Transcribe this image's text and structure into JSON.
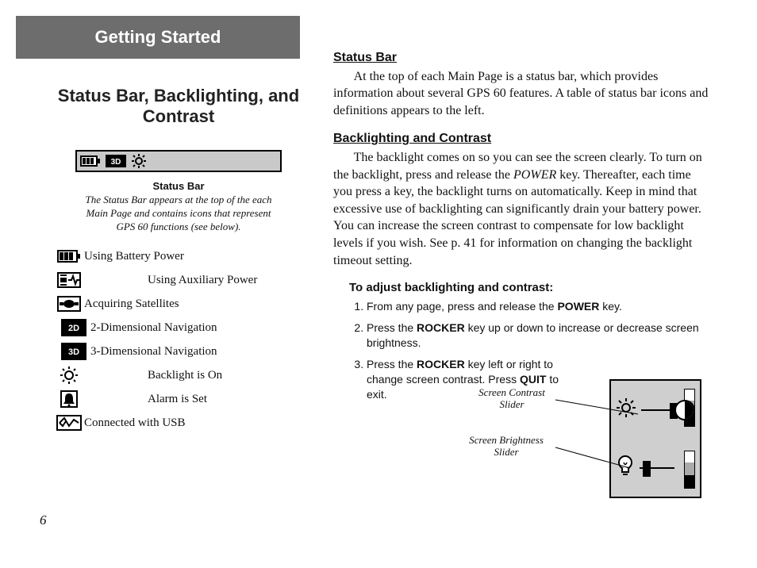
{
  "chapter": "Getting Started",
  "section_title": "Status Bar, Backlighting, and Contrast",
  "statusbar_caption_head": "Status Bar",
  "statusbar_caption": "The Status Bar appears at the top of the each Main Page and contains icons that represent GPS 60 functions (see below).",
  "icons": [
    {
      "id": "battery",
      "label": "Using Battery Power",
      "indent": false
    },
    {
      "id": "aux-power",
      "label": "Using Auxiliary Power",
      "indent": true
    },
    {
      "id": "sat",
      "label": "Acquiring Satellites",
      "indent": false
    },
    {
      "id": "nav2d",
      "label": "2-Dimensional Navigation",
      "indent": false,
      "short": true
    },
    {
      "id": "nav3d",
      "label": "3-Dimensional Navigation",
      "indent": false,
      "short": true
    },
    {
      "id": "backlight",
      "label": "Backlight is On",
      "indent": true
    },
    {
      "id": "alarm",
      "label": "Alarm is Set",
      "indent": true
    },
    {
      "id": "usb",
      "label": "Connected with USB",
      "indent": false
    }
  ],
  "right": {
    "h1": "Status Bar",
    "p1": "At the top of each Main Page is a status bar, which provides information about several GPS 60 features. A table of status bar icons and definitions appears to the left.",
    "h2": "Backlighting and Contrast",
    "p2a": "The backlight comes on so you can see the screen clearly. To turn on the backlight, press and release the ",
    "p2_power": "POWER",
    "p2b": " key. Thereafter, each time you press a key, the backlight turns on automatically. Keep in mind that excessive use of backlighting can significantly drain your battery power. You can increase the screen contrast to compensate for low backlight levels if you wish. See p. 41 for information on changing the backlight timeout setting.",
    "proc_head": "To adjust backlighting and contrast:",
    "steps": {
      "s1a": "From any page, press and release the ",
      "s1_power": "POWER",
      "s1b": " key.",
      "s2a": "Press the ",
      "s2_rocker": "ROCKER",
      "s2b": " key up or down to increase or decrease screen brightness.",
      "s3a": "Press the ",
      "s3_rocker": "ROCKER",
      "s3b": " key left or right to change screen contrast. Press ",
      "s3_quit": "QUIT",
      "s3c": " to exit."
    }
  },
  "callouts": {
    "contrast": "Screen Contrast Slider",
    "brightness": "Screen Brightness Slider"
  },
  "page_number": "6"
}
